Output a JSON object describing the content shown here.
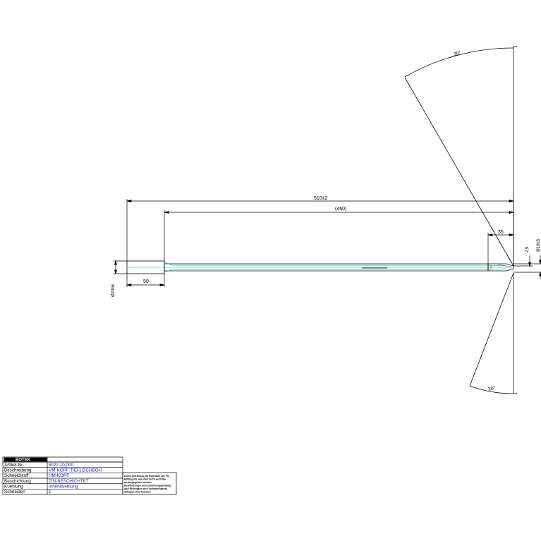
{
  "dimensions": {
    "overall_length": "510±2",
    "flute_length": "(460)",
    "shank_length": "50",
    "tip_length": "35",
    "tip_offset": "2,5",
    "tip_diameter": "Ø10h5",
    "shank_diameter": "Ø20h6",
    "angle_top": "30°",
    "angle_bottom": "20°"
  },
  "title_block": {
    "logo": "BOTEK",
    "rows": [
      {
        "label": "Artikel-Nr.",
        "value": "5022 10,000"
      },
      {
        "label": "Beschreibung",
        "value": "VM-KOPF TIEFLOCHBOH"
      },
      {
        "label": "Schneidstoff",
        "value": "HM-KOPF"
      },
      {
        "label": "Beschichtung",
        "value": "TIN-BESCHICHTET"
      },
      {
        "label": "Kuehlung",
        "value": "Innenkuehlung"
      },
      {
        "label": "Schneiden",
        "value": "1"
      }
    ],
    "note_lines": [
      "Diese Zeichnung ist Eigentum der Fa.",
      "Bötling KG und darf nicht an Dritte",
      "weitergegeben werden.",
      "Bearbeitungs- und Zeichnungsprüfung",
      "(auf Richtigkeit und Vollständigkeit)",
      "obliegen dem Kunden."
    ]
  },
  "colors": {
    "line": "#000000",
    "coolant_channel": "#00c8d8",
    "axis_line": "#2ab52a",
    "value_text": "#1a1aff"
  }
}
